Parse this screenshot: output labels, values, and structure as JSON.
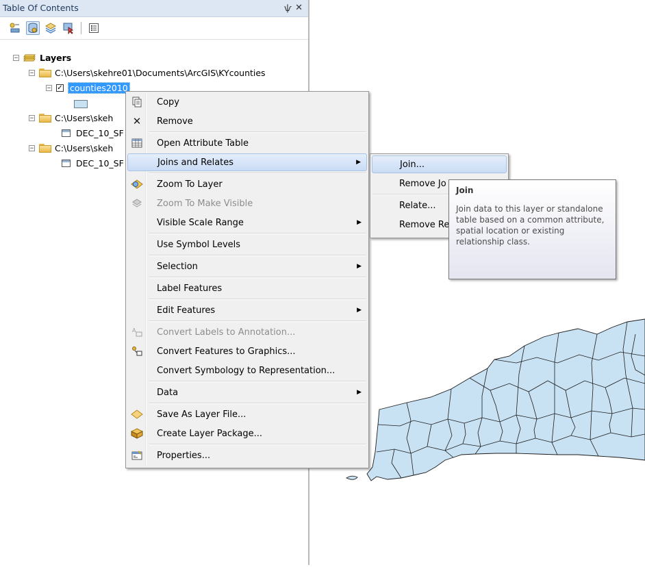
{
  "toc": {
    "title": "Table Of Contents",
    "pin_glyph": "ѱ",
    "close_glyph": "✕",
    "tree": {
      "root_label": "Layers",
      "group1_path": "C:\\Users\\skehre01\\Documents\\ArcGIS\\KYcounties",
      "layer_name": "counties2010",
      "group2_path": "C:\\Users\\skeh",
      "table2_name": "DEC_10_SF",
      "group3_path": "C:\\Users\\skeh",
      "table3_name": "DEC_10_SF"
    }
  },
  "context_menu": {
    "items": [
      {
        "label": "Copy",
        "icon": "copy-icon"
      },
      {
        "label": "Remove",
        "icon": "remove-icon"
      },
      {
        "label": "Open Attribute Table",
        "icon": "attribute-table-icon"
      },
      {
        "label": "Joins and Relates",
        "icon": "",
        "submenu": true
      },
      {
        "label": "Zoom To Layer",
        "icon": "zoom-to-layer-icon"
      },
      {
        "label": "Zoom To Make Visible",
        "icon": "zoom-visible-icon",
        "disabled": true
      },
      {
        "label": "Visible Scale Range",
        "icon": "",
        "submenu": true
      },
      {
        "label": "Use Symbol Levels",
        "icon": ""
      },
      {
        "label": "Selection",
        "icon": "",
        "submenu": true
      },
      {
        "label": "Label Features",
        "icon": ""
      },
      {
        "label": "Edit Features",
        "icon": "",
        "submenu": true
      },
      {
        "label": "Convert Labels to Annotation...",
        "icon": "convert-labels-icon",
        "disabled": true
      },
      {
        "label": "Convert Features to Graphics...",
        "icon": "convert-features-icon"
      },
      {
        "label": "Convert Symbology to Representation...",
        "icon": ""
      },
      {
        "label": "Data",
        "icon": "",
        "submenu": true
      },
      {
        "label": "Save As Layer File...",
        "icon": "layer-file-icon"
      },
      {
        "label": "Create Layer Package...",
        "icon": "layer-package-icon"
      },
      {
        "label": "Properties...",
        "icon": "properties-icon"
      }
    ]
  },
  "submenu": {
    "items": [
      "Join...",
      "Remove Jo",
      "Relate...",
      "Remove Re"
    ]
  },
  "tooltip": {
    "title": "Join",
    "body": "Join data to this layer or standalone table based on a common attribute, spatial location or existing relationship class."
  },
  "colors": {
    "selection": "#3399ff",
    "county_fill": "#c9e2f3",
    "menu_bg": "#f0f0f0",
    "highlight": "#c9dcf5"
  }
}
